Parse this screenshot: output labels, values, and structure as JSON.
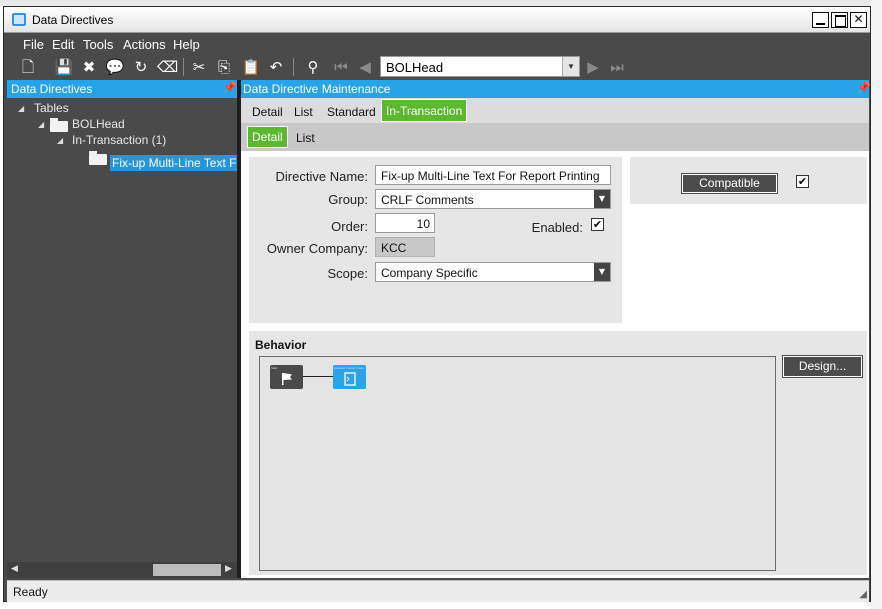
{
  "window": {
    "title": "Data Directives"
  },
  "menu": [
    "File",
    "Edit",
    "Tools",
    "Actions",
    "Help"
  ],
  "toolbar": {
    "selector_value": "BOLHead"
  },
  "left_panel": {
    "title": "Data Directives",
    "tree": {
      "root": "Tables",
      "table": "BOLHead",
      "group": "In-Transaction (1)",
      "directive": "Fix-up Multi-Line Text For Report Printing"
    }
  },
  "right_panel": {
    "title": "Data Directive Maintenance",
    "tabs": [
      "Detail",
      "List",
      "Standard",
      "In-Transaction"
    ],
    "subtabs": [
      "Detail",
      "List"
    ]
  },
  "form": {
    "directive_name_label": "Directive Name:",
    "directive_name": "Fix-up Multi-Line Text For Report Printing",
    "group_label": "Group:",
    "group": "CRLF Comments",
    "order_label": "Order:",
    "order": "10",
    "enabled_label": "Enabled:",
    "enabled": true,
    "owner_label": "Owner Company:",
    "owner": "KCC",
    "scope_label": "Scope:",
    "scope": "Company Specific",
    "compatible_label": "Compatible",
    "compatible": true
  },
  "behavior": {
    "label": "Behavior",
    "design_label": "Design...",
    "nodes": [
      {
        "caption": "Start"
      },
      {
        "caption": "Execute Custom Code"
      }
    ]
  },
  "status": "Ready",
  "colors": {
    "accent": "#29a3e8",
    "active_tab": "#5cb82e",
    "panel_dark": "#4a4a4a"
  }
}
